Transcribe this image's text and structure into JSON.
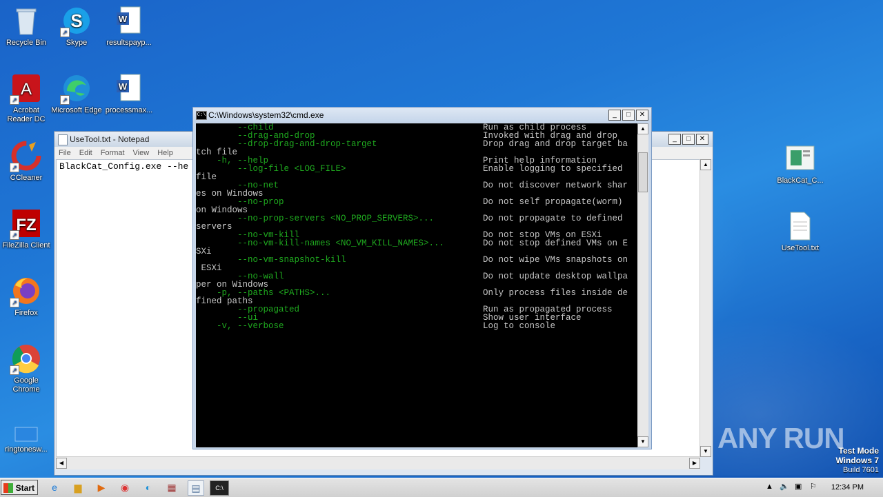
{
  "desktop": {
    "icons": [
      {
        "label": "Recycle Bin",
        "icon": "recycle-bin-icon"
      },
      {
        "label": "Skype",
        "icon": "skype-icon"
      },
      {
        "label": "resultspayp...",
        "icon": "word-doc-icon"
      },
      {
        "label": "Acrobat Reader DC",
        "icon": "acrobat-icon"
      },
      {
        "label": "Microsoft Edge",
        "icon": "edge-icon"
      },
      {
        "label": "processmax...",
        "icon": "word-doc-icon"
      },
      {
        "label": "CCleaner",
        "icon": "ccleaner-icon"
      },
      {
        "label": "FileZilla Client",
        "icon": "filezilla-icon"
      },
      {
        "label": "Firefox",
        "icon": "firefox-icon"
      },
      {
        "label": "Google Chrome",
        "icon": "chrome-icon"
      },
      {
        "label": "ringtonesw...",
        "icon": "blank-file-icon"
      },
      {
        "label": "BlackCat_C...",
        "icon": "exe-icon"
      },
      {
        "label": "UseTool.txt",
        "icon": "text-file-icon"
      }
    ]
  },
  "notepad": {
    "title": "UseTool.txt - Notepad",
    "menu": [
      "File",
      "Edit",
      "Format",
      "View",
      "Help"
    ],
    "content": "BlackCat_Config.exe --he"
  },
  "cmd": {
    "title": "C:\\Windows\\system32\\cmd.exe",
    "lines": [
      {
        "opt": "        --child",
        "desc": "Run as child process"
      },
      {
        "opt": "        --drag-and-drop",
        "desc": "Invoked with drag and drop"
      },
      {
        "opt": "        --drop-drag-and-drop-target",
        "desc": "Drop drag and drop target ba"
      },
      {
        "plain": "tch file"
      },
      {
        "opt": "    -h, --help",
        "desc": "Print help information"
      },
      {
        "opt": "        --log-file <LOG_FILE>",
        "desc": "Enable logging to specified"
      },
      {
        "plain": "file"
      },
      {
        "opt": "        --no-net",
        "desc": "Do not discover network shar"
      },
      {
        "plain": "es on Windows"
      },
      {
        "opt": "        --no-prop",
        "desc": "Do not self propagate(worm)"
      },
      {
        "plain": "on Windows"
      },
      {
        "opt": "        --no-prop-servers <NO_PROP_SERVERS>...",
        "desc": "Do not propagate to defined"
      },
      {
        "plain": "servers"
      },
      {
        "opt": "        --no-vm-kill",
        "desc": "Do not stop VMs on ESXi"
      },
      {
        "opt": "        --no-vm-kill-names <NO_VM_KILL_NAMES>...",
        "desc": "Do not stop defined VMs on E"
      },
      {
        "plain": "SXi"
      },
      {
        "opt": "        --no-vm-snapshot-kill",
        "desc": "Do not wipe VMs snapshots on"
      },
      {
        "plain": " ESXi"
      },
      {
        "opt": "        --no-wall",
        "desc": "Do not update desktop wallpa"
      },
      {
        "plain": "per on Windows"
      },
      {
        "opt": "    -p, --paths <PATHS>...",
        "desc": "Only process files inside de"
      },
      {
        "plain": "fined paths"
      },
      {
        "opt": "        --propagated",
        "desc": "Run as propagated process"
      },
      {
        "opt": "        --ui",
        "desc": "Show user interface"
      },
      {
        "opt": "    -v, --verbose",
        "desc": "Log to console"
      }
    ]
  },
  "watermark": "ANY RUN",
  "testmode": {
    "line1": "Test Mode",
    "line2": "Windows 7",
    "line3": "Build 7601"
  },
  "taskbar": {
    "start_label": "Start",
    "clock": "12:34 PM"
  }
}
